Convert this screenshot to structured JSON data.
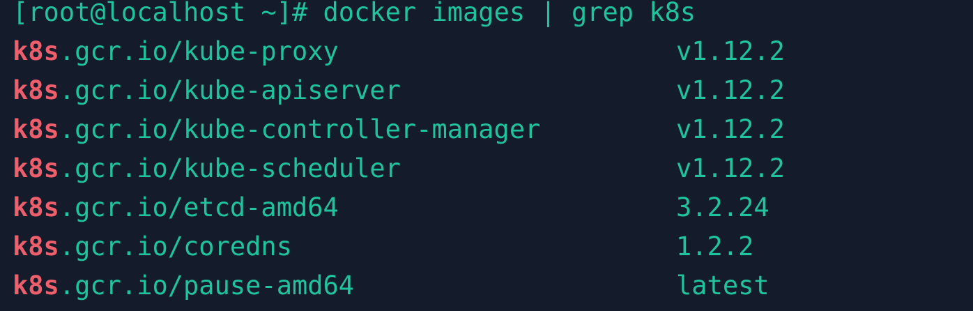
{
  "terminal": {
    "prompt": "[root@localhost ~]#",
    "command": "docker images | grep k8s",
    "highlight_term": "k8s",
    "rows": [
      {
        "highlight": "k8s",
        "rest": ".gcr.io/kube-proxy",
        "tag": "v1.12.2"
      },
      {
        "highlight": "k8s",
        "rest": ".gcr.io/kube-apiserver",
        "tag": "v1.12.2"
      },
      {
        "highlight": "k8s",
        "rest": ".gcr.io/kube-controller-manager",
        "tag": "v1.12.2"
      },
      {
        "highlight": "k8s",
        "rest": ".gcr.io/kube-scheduler",
        "tag": "v1.12.2"
      },
      {
        "highlight": "k8s",
        "rest": ".gcr.io/etcd-amd64",
        "tag": "3.2.24"
      },
      {
        "highlight": "k8s",
        "rest": ".gcr.io/coredns",
        "tag": "1.2.2"
      },
      {
        "highlight": "k8s",
        "rest": ".gcr.io/pause-amd64",
        "tag": "latest"
      }
    ]
  },
  "colors": {
    "background": "#141b2a",
    "text": "#1fc3a0",
    "highlight": "#ee5f6b"
  }
}
